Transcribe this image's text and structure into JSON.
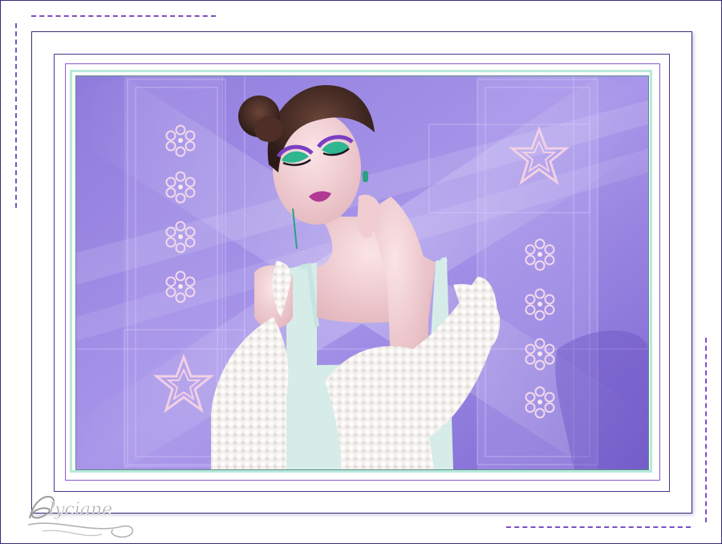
{
  "image": {
    "subject": "woman-with-green-eyeshadow-white-fur-jacket",
    "colors": {
      "background_lavender": "#9a86e2",
      "deep_purple": "#6f59c9",
      "border_dark": "#3b2a7a",
      "border_purple": "#8a5cd0",
      "mint_accent": "#b8e8dc",
      "ornament_pink": "#f0d6ea",
      "dash_purple": "#7c4fc4"
    },
    "signature": {
      "text": "Alyciane"
    }
  }
}
